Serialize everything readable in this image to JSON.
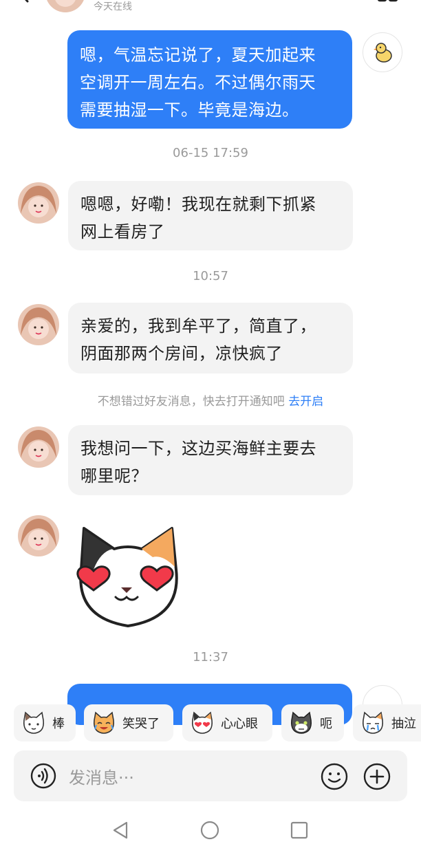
{
  "header": {
    "status": "今天在线",
    "back_icon": "chevron-left-icon",
    "more_icon": "grid-menu-icon"
  },
  "messages": [
    {
      "from": "me",
      "text": "嗯，气温忘记说了，夏天加起来\n空调开一周左右。不过偶尔雨天\n需要抽湿一下。毕竟是海边。"
    },
    {
      "time": "06-15 17:59"
    },
    {
      "from": "other",
      "text": "嗯嗯，好嘞！我现在就剩下抓紧\n网上看房了"
    },
    {
      "time": "10:57"
    },
    {
      "from": "other",
      "text": "亲爱的，我到牟平了，简直了，\n阴面那两个房间，凉快疯了"
    },
    {
      "from": "other",
      "text": "我想问一下，这边买海鲜主要去\n哪里呢？"
    },
    {
      "from": "other",
      "sticker": "cat-heart-eyes-sticker"
    },
    {
      "time": "11:37"
    }
  ],
  "notice": {
    "text": "不想错过好友消息，快去打开通知吧 ",
    "link": "去开启"
  },
  "quick_emojis": [
    {
      "label": "棒",
      "icon": "cat-thumbs-up-icon"
    },
    {
      "label": "笑哭了",
      "icon": "cat-laugh-cry-icon"
    },
    {
      "label": "心心眼",
      "icon": "cat-heart-eyes-icon"
    },
    {
      "label": "呃",
      "icon": "cat-awkward-icon"
    },
    {
      "label": "抽泣",
      "icon": "cat-sob-icon"
    }
  ],
  "input": {
    "placeholder": "发消息···"
  },
  "colors": {
    "accent": "#2e7ff7",
    "bubble_other": "#f3f3f3",
    "timestamp": "#9a9a9a"
  }
}
